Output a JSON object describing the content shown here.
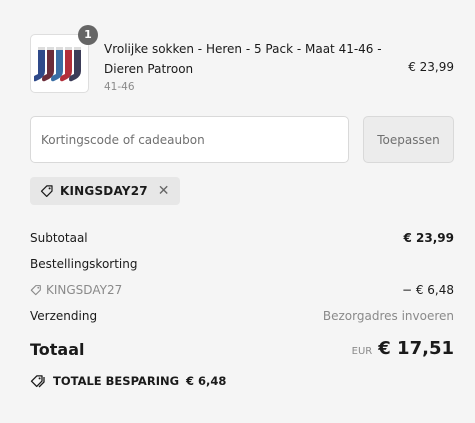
{
  "product": {
    "title": "Vrolijke sokken - Heren - 5 Pack - Maat 41-46 - Dieren Patroon",
    "variant": "41-46",
    "price": "€ 23,99",
    "quantity": "1",
    "image_icon": "socks-product-image"
  },
  "discount": {
    "placeholder": "Kortingscode of cadeaubon",
    "value": "",
    "apply_label": "Toepassen"
  },
  "applied_code": {
    "code": "KINGSDAY27",
    "icon": "tag-icon",
    "remove_icon": "close-icon"
  },
  "summary": {
    "subtotal_label": "Subtotaal",
    "subtotal_value": "€ 23,99",
    "order_discount_label": "Bestellingskorting",
    "discount_code": "KINGSDAY27",
    "discount_value": "− € 6,48",
    "shipping_label": "Verzending",
    "shipping_value": "Bezorgadres invoeren"
  },
  "total": {
    "label": "Totaal",
    "currency": "EUR",
    "amount": "€ 17,51"
  },
  "savings": {
    "label": "TOTALE BESPARING",
    "amount": "€ 6,48",
    "icon": "tags-icon"
  },
  "colors": {
    "background": "#f5f5f5",
    "badge": "#666666",
    "muted_text": "#8a8a8a",
    "chip_bg": "#e7e7e7"
  }
}
